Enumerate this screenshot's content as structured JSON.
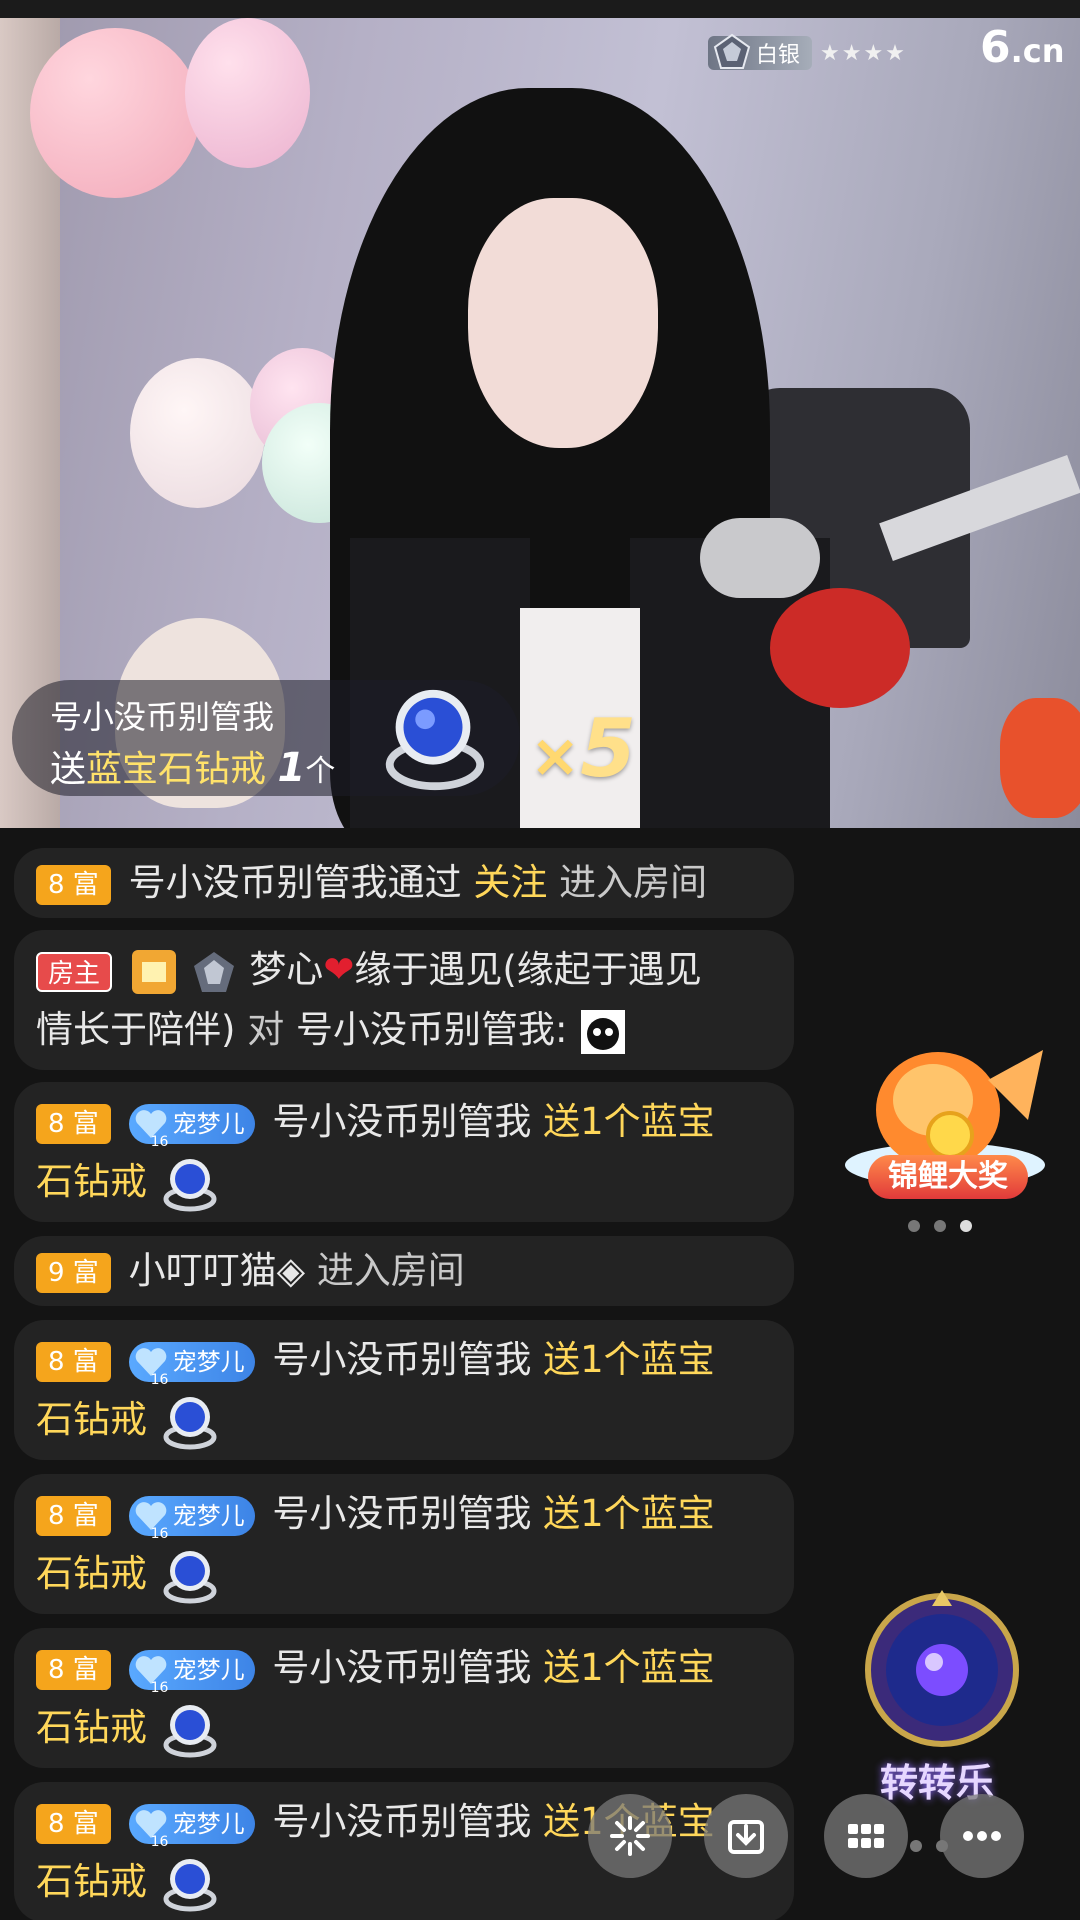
{
  "stream": {
    "rank_label": "白银",
    "rank_stars": "★★★★",
    "logo": "6",
    "logo_suffix": ".cn"
  },
  "gift_banner": {
    "username": "号小没币别管我",
    "send_word": "送",
    "gift_name": "蓝宝石钻戒",
    "count": "1",
    "unit": "个",
    "combo_x": "×",
    "combo_count": "5"
  },
  "chat": [
    {
      "level": "8 富",
      "user": "号小没币别管我通过",
      "action": "关注",
      "rest": "进入房间"
    },
    {
      "host_tag": "房主",
      "user": "梦心",
      "heart": "❤",
      "text1": "缘于遇见(缘起于遇见",
      "text2": "情长于陪伴)",
      "to": "对",
      "target": "号小没币别管我:"
    },
    {
      "level": "8 富",
      "fan_name": "宠梦儿",
      "fan_level": "16",
      "user": "号小没币别管我",
      "gift_text1": "送1个蓝宝",
      "gift_text2": "石钻戒"
    },
    {
      "level": "9 富",
      "user": "小叮叮猫◈",
      "rest": "进入房间"
    },
    {
      "level": "8 富",
      "fan_name": "宠梦儿",
      "fan_level": "16",
      "user": "号小没币别管我",
      "gift_text1": "送1个蓝宝",
      "gift_text2": "石钻戒"
    },
    {
      "level": "8 富",
      "fan_name": "宠梦儿",
      "fan_level": "16",
      "user": "号小没币别管我",
      "gift_text1": "送1个蓝宝",
      "gift_text2": "石钻戒"
    },
    {
      "level": "8 富",
      "fan_name": "宠梦儿",
      "fan_level": "16",
      "user": "号小没币别管我",
      "gift_text1": "送1个蓝宝",
      "gift_text2": "石钻戒"
    },
    {
      "level": "8 富",
      "fan_name": "宠梦儿",
      "fan_level": "16",
      "user": "号小没币别管我",
      "gift_text1": "送1个蓝宝",
      "gift_text2": "石钻戒"
    }
  ],
  "side": {
    "carp_label": "锦鲤大奖",
    "wheel_label": "转转乐"
  },
  "icons": {
    "effects": "sparkle-icon",
    "download": "download-icon",
    "grid": "grid-icon",
    "more": "more-icon"
  },
  "colors": {
    "level_badge": "#f5a51c",
    "gold_text": "#ffd75a",
    "host_badge": "#e74b4b",
    "fan_badge": "#3d84e6"
  }
}
